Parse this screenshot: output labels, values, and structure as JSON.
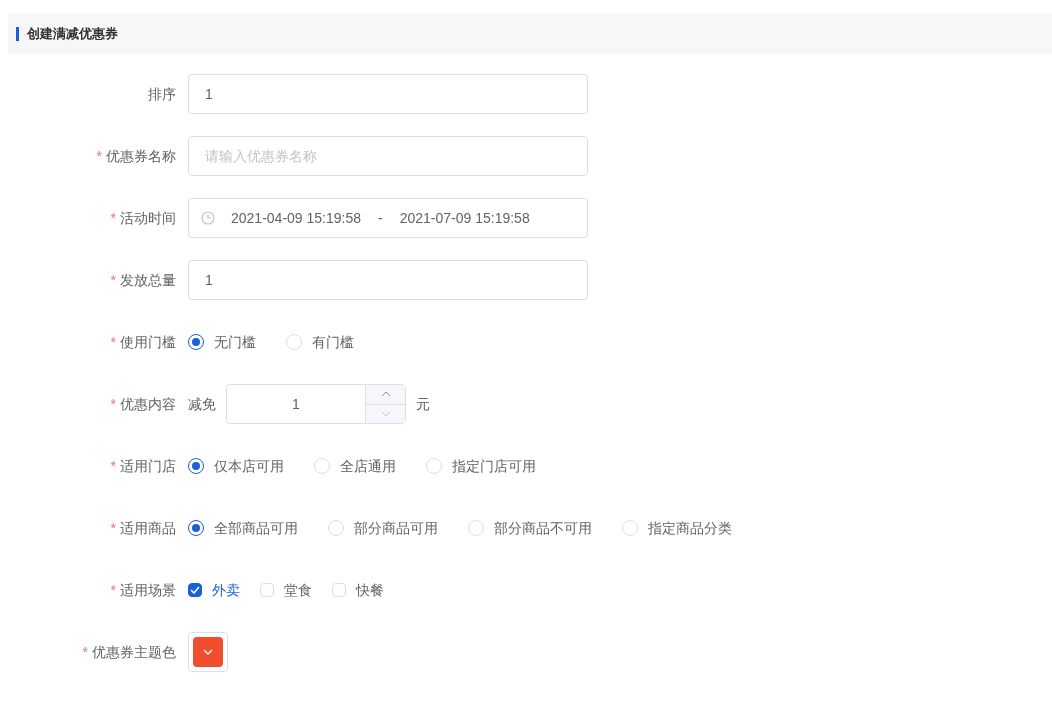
{
  "header": {
    "title": "创建满减优惠券"
  },
  "fields": [
    {
      "kind": "text",
      "label": "排序",
      "value": "1"
    },
    {
      "kind": "text",
      "mark": "*",
      "label": "优惠券名称",
      "placeholder": "请输入优惠券名称"
    },
    {
      "kind": "daterange",
      "mark": "*",
      "label": "活动时间",
      "start": "2021-04-09 15:19:58",
      "separator": "-",
      "end": "2021-07-09 15:19:58"
    },
    {
      "kind": "text",
      "mark": "*",
      "label": "发放总量",
      "value": "1"
    },
    {
      "kind": "radio",
      "mark": "*",
      "label": "使用门槛",
      "options": [
        {
          "label": "无门槛",
          "selected": true
        },
        {
          "label": "有门槛",
          "selected": false
        }
      ]
    },
    {
      "kind": "number",
      "mark": "*",
      "label": "优惠内容",
      "prefix": "减免",
      "value": "1",
      "suffix": "元"
    },
    {
      "kind": "radio",
      "mark": "*",
      "label": "适用门店",
      "options": [
        {
          "label": "仅本店可用",
          "selected": true
        },
        {
          "label": "全店通用",
          "selected": false
        },
        {
          "label": "指定门店可用",
          "selected": false
        }
      ]
    },
    {
      "kind": "radio",
      "mark": "*",
      "label": "适用商品",
      "options": [
        {
          "label": "全部商品可用",
          "selected": true
        },
        {
          "label": "部分商品可用",
          "selected": false
        },
        {
          "label": "部分商品不可用",
          "selected": false
        },
        {
          "label": "指定商品分类",
          "selected": false
        }
      ]
    },
    {
      "kind": "checkbox",
      "mark": "*",
      "label": "适用场景",
      "options": [
        {
          "label": "外卖",
          "checked": true
        },
        {
          "label": "堂食",
          "checked": false
        },
        {
          "label": "快餐",
          "checked": false
        }
      ]
    },
    {
      "kind": "color",
      "mark": "*",
      "label": "优惠券主题色",
      "color": "#f04e2f"
    }
  ]
}
